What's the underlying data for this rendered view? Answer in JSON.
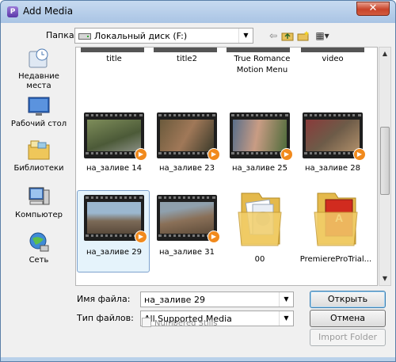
{
  "window": {
    "title": "Add Media",
    "close_glyph": "✕",
    "app_icon_letter": "P"
  },
  "lookin": {
    "label": "Папка:",
    "value": "Локальный диск (F:)",
    "icon": "drive-icon"
  },
  "toolbar": {
    "back_icon": "back-arrow-icon",
    "up_icon": "up-folder-icon",
    "newfolder_icon": "new-folder-icon",
    "views_icon": "views-menu-icon",
    "back_glyph": "⇦",
    "views_glyph": "▦▾"
  },
  "places": [
    {
      "label": "Недавние места",
      "icon": "recent-places-icon"
    },
    {
      "label": "Рабочий стол",
      "icon": "desktop-icon"
    },
    {
      "label": "Библиотеки",
      "icon": "libraries-icon"
    },
    {
      "label": "Компьютер",
      "icon": "computer-icon"
    },
    {
      "label": "Сеть",
      "icon": "network-icon"
    }
  ],
  "files": {
    "top_row": [
      "title",
      "title2",
      "True Romance Motion Menu",
      "video"
    ],
    "items": [
      {
        "name": "на_заливе 14",
        "kind": "video"
      },
      {
        "name": "на_заливе 23",
        "kind": "video"
      },
      {
        "name": "на_заливе 25",
        "kind": "video"
      },
      {
        "name": "на_заливе 28",
        "kind": "video"
      },
      {
        "name": "на_заливе 29",
        "kind": "video",
        "selected": true
      },
      {
        "name": "на_заливе 31",
        "kind": "video"
      },
      {
        "name": "00",
        "kind": "folder"
      },
      {
        "name": "PremiereProTrial...",
        "kind": "folder"
      }
    ]
  },
  "filename": {
    "label": "Имя файла:",
    "value": "на_заливе 29"
  },
  "filetype": {
    "label": "Тип файлов:",
    "value": "All Supported Media"
  },
  "buttons": {
    "open": "Открыть",
    "cancel": "Отмена",
    "import_folder": "Import Folder"
  },
  "numbered_stills": {
    "label": "Numbered Stills",
    "checked": false,
    "enabled": false
  },
  "colors": {
    "selection": "#e5f3fb",
    "play_badge": "#f18a1d",
    "titlebar": "#b9d1ea"
  }
}
